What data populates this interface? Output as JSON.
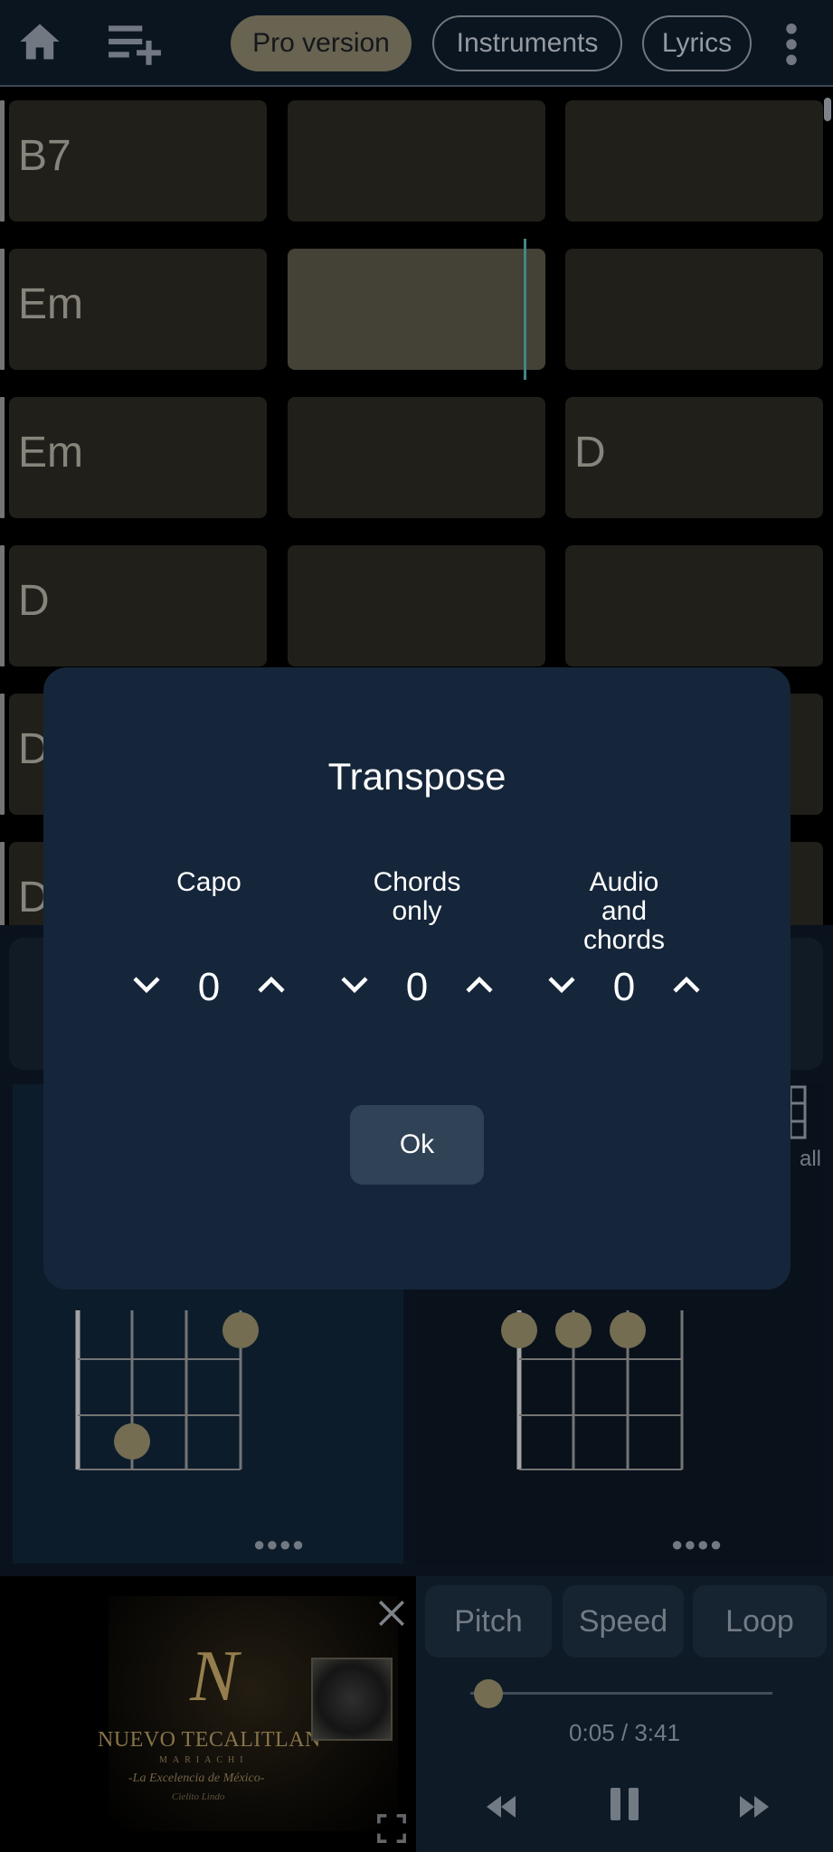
{
  "topbar": {
    "pro_label": "Pro version",
    "instruments_label": "Instruments",
    "lyrics_label": "Lyrics"
  },
  "chord_grid": {
    "rows": [
      [
        "B7",
        "",
        ""
      ],
      [
        "Em",
        "",
        ""
      ],
      [
        "Em",
        "",
        "D"
      ],
      [
        "D",
        "",
        ""
      ],
      [
        "D",
        "",
        ""
      ],
      [
        "D",
        "",
        ""
      ]
    ],
    "active_cell": "row 2, column 2"
  },
  "chord_diagrams": {
    "view_all_label": "all"
  },
  "player": {
    "video_title": "NUEVO TECALITLAN",
    "video_subtitle": "MARIACHI",
    "video_tagline": "-La Excelencia de México-",
    "video_song": "Cielito Lindo",
    "pitch_label": "Pitch",
    "speed_label": "Speed",
    "loop_label": "Loop",
    "time_display": "0:05 / 3:41",
    "progress_fraction": 0.023
  },
  "dialog": {
    "title": "Transpose",
    "columns": [
      {
        "label": "Capo",
        "value": "0"
      },
      {
        "label": "Chords\nonly",
        "value": "0"
      },
      {
        "label": "Audio\nand\nchords",
        "value": "0"
      }
    ],
    "ok_label": "Ok"
  },
  "colors": {
    "accent_gold": "#8e8665",
    "cursor_teal": "#4ea5a0",
    "dialog_bg": "#15263a"
  }
}
